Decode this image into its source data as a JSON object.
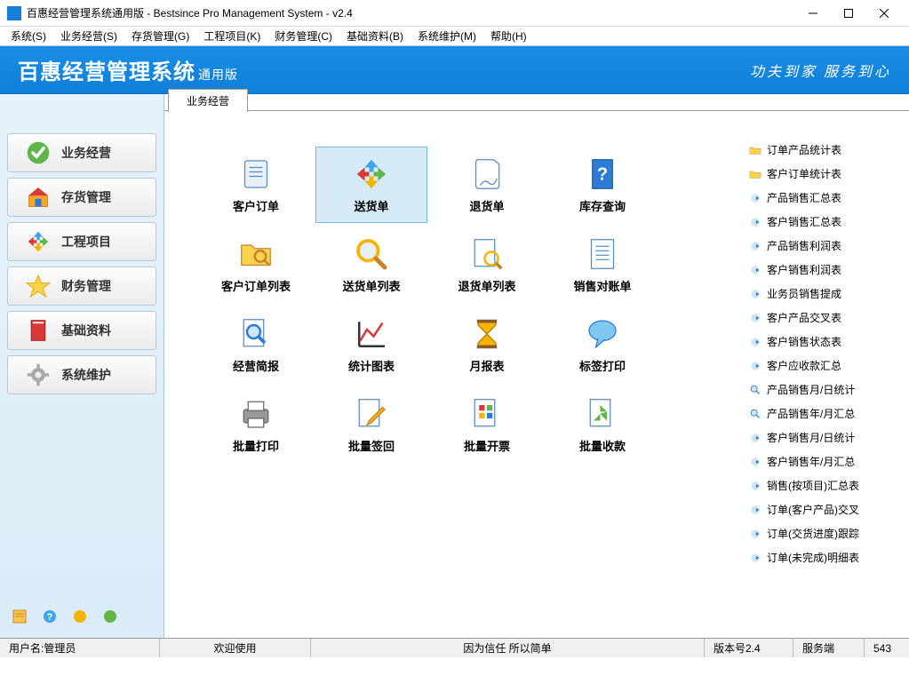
{
  "title": "百惠经营管理系统通用版 - Bestsince Pro Management System - v2.4",
  "menus": [
    "系统(S)",
    "业务经营(S)",
    "存货管理(G)",
    "工程项目(K)",
    "财务管理(C)",
    "基础资料(B)",
    "系统维护(M)",
    "帮助(H)"
  ],
  "banner": {
    "brand": "百惠经营管理系统",
    "sub": "通用版",
    "slogan": "功夫到家 服务到心"
  },
  "sidebar": [
    {
      "label": "业务经营",
      "icon": "check"
    },
    {
      "label": "存货管理",
      "icon": "house"
    },
    {
      "label": "工程项目",
      "icon": "arrows"
    },
    {
      "label": "财务管理",
      "icon": "star"
    },
    {
      "label": "基础资料",
      "icon": "book"
    },
    {
      "label": "系统维护",
      "icon": "gear"
    }
  ],
  "activeTab": "业务经营",
  "grid": [
    {
      "label": "客户订单",
      "icon": "scroll"
    },
    {
      "label": "送货单",
      "icon": "arrows",
      "selected": true
    },
    {
      "label": "退货单",
      "icon": "sheet"
    },
    {
      "label": "库存查询",
      "icon": "bookhelp"
    },
    {
      "label": "客户订单列表",
      "icon": "folder-search"
    },
    {
      "label": "送货单列表",
      "icon": "magnifier"
    },
    {
      "label": "退货单列表",
      "icon": "doc-search"
    },
    {
      "label": "销售对账单",
      "icon": "doclines"
    },
    {
      "label": "经营简报",
      "icon": "doc-mag"
    },
    {
      "label": "统计图表",
      "icon": "chart"
    },
    {
      "label": "月报表",
      "icon": "hourglass"
    },
    {
      "label": "标签打印",
      "icon": "bubble"
    },
    {
      "label": "批量打印",
      "icon": "printer"
    },
    {
      "label": "批量签回",
      "icon": "doc-edit"
    },
    {
      "label": "批量开票",
      "icon": "doc-blocks"
    },
    {
      "label": "批量收款",
      "icon": "doc-recycle"
    }
  ],
  "links": [
    {
      "label": "订单产品统计表",
      "icon": "folder-y"
    },
    {
      "label": "客户订单统计表",
      "icon": "folder-y"
    },
    {
      "label": "产品销售汇总表",
      "icon": "arrow-b"
    },
    {
      "label": "客户销售汇总表",
      "icon": "arrow-b"
    },
    {
      "label": "产品销售利润表",
      "icon": "arrow-b"
    },
    {
      "label": "客户销售利润表",
      "icon": "arrow-b"
    },
    {
      "label": "业务员销售提成",
      "icon": "arrow-b"
    },
    {
      "label": "客户产品交叉表",
      "icon": "arrow-b"
    },
    {
      "label": "客户销售状态表",
      "icon": "arrow-b"
    },
    {
      "label": "客户应收款汇总",
      "icon": "arrow-b"
    },
    {
      "label": "产品销售月/日统计",
      "icon": "mag-b"
    },
    {
      "label": "产品销售年/月汇总",
      "icon": "mag-b"
    },
    {
      "label": "客户销售月/日统计",
      "icon": "arrow-b"
    },
    {
      "label": "客户销售年/月汇总",
      "icon": "arrow-b"
    },
    {
      "label": "销售(按项目)汇总表",
      "icon": "arrow-b"
    },
    {
      "label": "订单(客户产品)交叉",
      "icon": "arrow-b"
    },
    {
      "label": "订单(交货进度)跟踪",
      "icon": "arrow-b"
    },
    {
      "label": "订单(未完成)明细表",
      "icon": "arrow-b"
    }
  ],
  "status": {
    "user_label": "用户名:管理员",
    "welcome": "欢迎使用",
    "motto": "因为信任 所以简单",
    "version": "版本号2.4",
    "server": "服务端",
    "count": "543"
  }
}
